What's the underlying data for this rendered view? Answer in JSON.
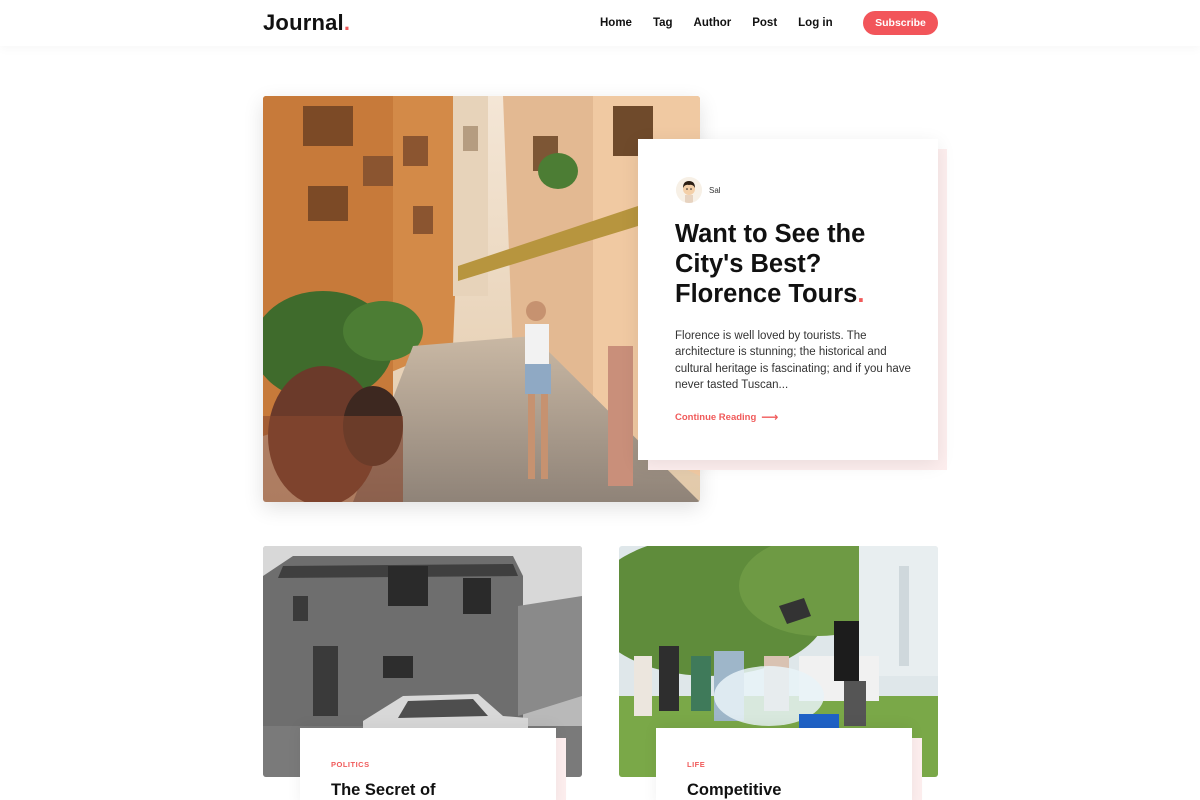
{
  "header": {
    "logo_text": "Journal",
    "logo_dot": ".",
    "nav": [
      "Home",
      "Tag",
      "Author",
      "Post",
      "Log in"
    ],
    "subscribe_label": "Subscribe"
  },
  "featured": {
    "author": "Sal",
    "title": "Want to See the City's Best? Florence Tours",
    "title_dot": ".",
    "excerpt": "Florence is well loved by tourists. The architecture is stunning; the historical and cultural heritage is fascinating; and if you have never tasted Tuscan...",
    "continue_label": "Continue Reading",
    "continue_icon": "arrow-right-icon"
  },
  "posts": [
    {
      "category": "POLITICS",
      "title": "The Secret of"
    },
    {
      "category": "LIFE",
      "title": "Competitive"
    }
  ],
  "colors": {
    "accent": "#f05a5a",
    "subscribe_bg": "#f2555a",
    "card_shadow": "#fdeeee"
  }
}
